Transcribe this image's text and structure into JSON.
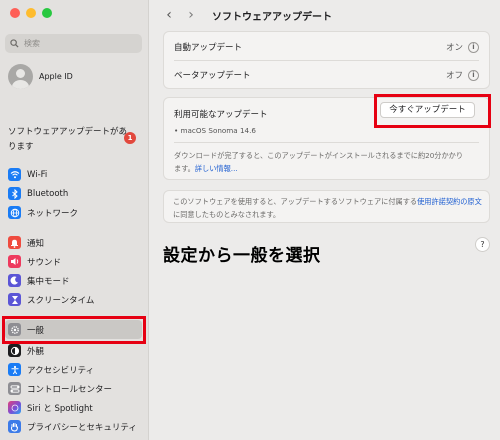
{
  "sidebar": {
    "search_placeholder": "検索",
    "apple_id": "Apple ID",
    "update_notice": "ソフトウェアアップデートがあります",
    "update_badge": "1",
    "items": [
      {
        "label": "Wi-Fi",
        "icon": "wifi-icon",
        "color": "#1a7cf5"
      },
      {
        "label": "Bluetooth",
        "icon": "bluetooth-icon",
        "color": "#1a7cf5"
      },
      {
        "label": "ネットワーク",
        "icon": "globe-icon",
        "color": "#1a7cf5"
      },
      {
        "label": "通知",
        "icon": "bell-icon",
        "color": "#ef4b3f"
      },
      {
        "label": "サウンド",
        "icon": "speaker-icon",
        "color": "#ee3a5e"
      },
      {
        "label": "集中モード",
        "icon": "moon-icon",
        "color": "#5b55d6"
      },
      {
        "label": "スクリーンタイム",
        "icon": "hourglass-icon",
        "color": "#5b55d6"
      },
      {
        "label": "一般",
        "icon": "gear-icon",
        "color": "#8e8e93"
      },
      {
        "label": "外観",
        "icon": "appearance-icon",
        "color": "#1d1d1f"
      },
      {
        "label": "アクセシビリティ",
        "icon": "accessibility-icon",
        "color": "#1a7cf5"
      },
      {
        "label": "コントロールセンター",
        "icon": "control-center-icon",
        "color": "#8e8e93"
      },
      {
        "label": "Siri と Spotlight",
        "icon": "siri-icon",
        "color": "#7a4fd6"
      },
      {
        "label": "プライバシーとセキュリティ",
        "icon": "hand-icon",
        "color": "#3c7be8"
      }
    ]
  },
  "main": {
    "title": "ソフトウェアアップデート",
    "auto_update": {
      "label": "自動アップデート",
      "value": "オン"
    },
    "beta_update": {
      "label": "ベータアップデート",
      "value": "オフ"
    },
    "available": {
      "label": "利用可能なアップデート",
      "button": "今すぐアップデート",
      "version": "• macOS Sonoma 14.6",
      "note_line1": "ダウンロードが完了すると、このアップデートがインストールされるまでに約20分かかり",
      "note_line2_prefix": "ます。",
      "note_link": "詳しい情報..."
    },
    "license_line1_prefix": "このソフトウェアを使用すると、アップデートするソフトウェアに付属する",
    "license_link": "使用許諾契約の原文",
    "license_line2": "に同意したものとみなされます。",
    "help": "?"
  },
  "annotation": "設定から一般を選択",
  "colors": {
    "highlight_frame": "#e60012",
    "link": "#1f5fd1",
    "badge": "#e2483d"
  }
}
